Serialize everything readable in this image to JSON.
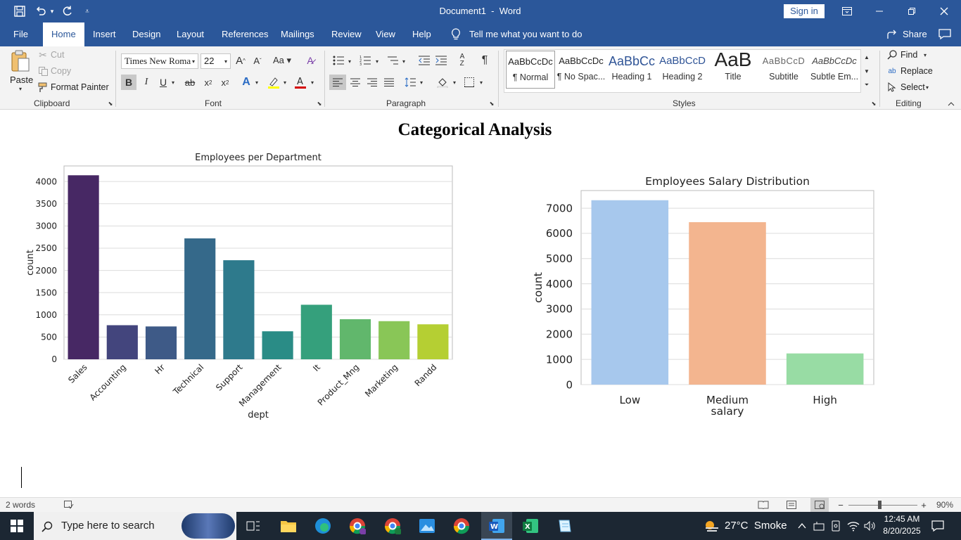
{
  "window": {
    "title": "Document1  -  Word",
    "sign_in": "Sign in"
  },
  "tabs": [
    "File",
    "Home",
    "Insert",
    "Design",
    "Layout",
    "References",
    "Mailings",
    "Review",
    "View",
    "Help"
  ],
  "tell_me": "Tell me what you want to do",
  "share": "Share",
  "clipboard": {
    "paste": "Paste",
    "cut": "Cut",
    "copy": "Copy",
    "format_painter": "Format Painter",
    "label": "Clipboard"
  },
  "font": {
    "name": "Times New Roma",
    "size": "22",
    "label": "Font"
  },
  "paragraph": {
    "label": "Paragraph"
  },
  "styles": {
    "label": "Styles",
    "items": [
      {
        "preview": "AaBbCcDc",
        "name": "¶ Normal"
      },
      {
        "preview": "AaBbCcDc",
        "name": "¶ No Spac..."
      },
      {
        "preview": "AaBbCc",
        "name": "Heading 1"
      },
      {
        "preview": "AaBbCcD",
        "name": "Heading 2"
      },
      {
        "preview": "AaB",
        "name": "Title"
      },
      {
        "preview": "AaBbCcD",
        "name": "Subtitle"
      },
      {
        "preview": "AaBbCcDc",
        "name": "Subtle Em..."
      }
    ]
  },
  "editing": {
    "find": "Find",
    "replace": "Replace",
    "select": "Select",
    "label": "Editing"
  },
  "document": {
    "heading": "Categorical Analysis"
  },
  "chart_data": [
    {
      "type": "bar",
      "title": "Employees per Department",
      "xlabel": "dept",
      "ylabel": "count",
      "categories": [
        "Sales",
        "Accounting",
        "Hr",
        "Technical",
        "Support",
        "Management",
        "It",
        "Product_Mng",
        "Marketing",
        "Randd"
      ],
      "values": [
        4140,
        767,
        739,
        2720,
        2229,
        630,
        1227,
        902,
        858,
        787
      ],
      "colors": [
        "#472864",
        "#43457d",
        "#3e5a87",
        "#35698a",
        "#2e7a8c",
        "#2a8c86",
        "#35a07c",
        "#61b76c",
        "#89c657",
        "#b5cf33"
      ],
      "yticks": [
        0,
        500,
        1000,
        1500,
        2000,
        2500,
        3000,
        3500,
        4000
      ],
      "ylim": [
        0,
        4350
      ],
      "grid": true
    },
    {
      "type": "bar",
      "title": "Employees Salary Distribution",
      "xlabel": "salary",
      "ylabel": "count",
      "categories": [
        "Low",
        "Medium",
        "High"
      ],
      "values": [
        7316,
        6446,
        1237
      ],
      "colors": [
        "#a7c8ed",
        "#f3b58f",
        "#98dca4"
      ],
      "yticks": [
        0,
        1000,
        2000,
        3000,
        4000,
        5000,
        6000,
        7000
      ],
      "ylim": [
        0,
        7700
      ],
      "grid": true
    }
  ],
  "status": {
    "words": "2 words",
    "zoom": "90%"
  },
  "taskbar": {
    "search_placeholder": "Type here to search",
    "weather": "27°C  Smoke",
    "time": "12:45 AM",
    "date": "8/20/2025"
  }
}
